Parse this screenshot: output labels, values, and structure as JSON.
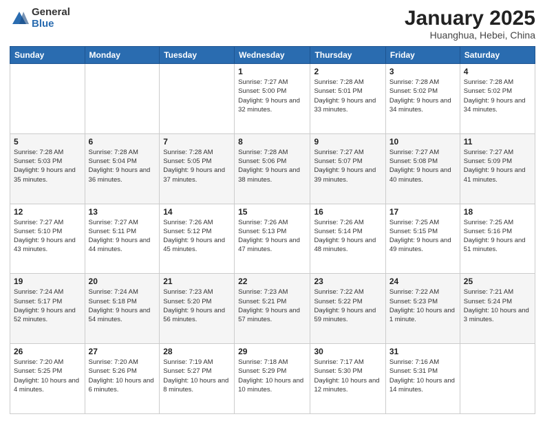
{
  "logo": {
    "general": "General",
    "blue": "Blue"
  },
  "title": "January 2025",
  "subtitle": "Huanghua, Hebei, China",
  "weekdays": [
    "Sunday",
    "Monday",
    "Tuesday",
    "Wednesday",
    "Thursday",
    "Friday",
    "Saturday"
  ],
  "weeks": [
    [
      {
        "day": "",
        "info": ""
      },
      {
        "day": "",
        "info": ""
      },
      {
        "day": "",
        "info": ""
      },
      {
        "day": "1",
        "info": "Sunrise: 7:27 AM\nSunset: 5:00 PM\nDaylight: 9 hours and 32 minutes."
      },
      {
        "day": "2",
        "info": "Sunrise: 7:28 AM\nSunset: 5:01 PM\nDaylight: 9 hours and 33 minutes."
      },
      {
        "day": "3",
        "info": "Sunrise: 7:28 AM\nSunset: 5:02 PM\nDaylight: 9 hours and 34 minutes."
      },
      {
        "day": "4",
        "info": "Sunrise: 7:28 AM\nSunset: 5:02 PM\nDaylight: 9 hours and 34 minutes."
      }
    ],
    [
      {
        "day": "5",
        "info": "Sunrise: 7:28 AM\nSunset: 5:03 PM\nDaylight: 9 hours and 35 minutes."
      },
      {
        "day": "6",
        "info": "Sunrise: 7:28 AM\nSunset: 5:04 PM\nDaylight: 9 hours and 36 minutes."
      },
      {
        "day": "7",
        "info": "Sunrise: 7:28 AM\nSunset: 5:05 PM\nDaylight: 9 hours and 37 minutes."
      },
      {
        "day": "8",
        "info": "Sunrise: 7:28 AM\nSunset: 5:06 PM\nDaylight: 9 hours and 38 minutes."
      },
      {
        "day": "9",
        "info": "Sunrise: 7:27 AM\nSunset: 5:07 PM\nDaylight: 9 hours and 39 minutes."
      },
      {
        "day": "10",
        "info": "Sunrise: 7:27 AM\nSunset: 5:08 PM\nDaylight: 9 hours and 40 minutes."
      },
      {
        "day": "11",
        "info": "Sunrise: 7:27 AM\nSunset: 5:09 PM\nDaylight: 9 hours and 41 minutes."
      }
    ],
    [
      {
        "day": "12",
        "info": "Sunrise: 7:27 AM\nSunset: 5:10 PM\nDaylight: 9 hours and 43 minutes."
      },
      {
        "day": "13",
        "info": "Sunrise: 7:27 AM\nSunset: 5:11 PM\nDaylight: 9 hours and 44 minutes."
      },
      {
        "day": "14",
        "info": "Sunrise: 7:26 AM\nSunset: 5:12 PM\nDaylight: 9 hours and 45 minutes."
      },
      {
        "day": "15",
        "info": "Sunrise: 7:26 AM\nSunset: 5:13 PM\nDaylight: 9 hours and 47 minutes."
      },
      {
        "day": "16",
        "info": "Sunrise: 7:26 AM\nSunset: 5:14 PM\nDaylight: 9 hours and 48 minutes."
      },
      {
        "day": "17",
        "info": "Sunrise: 7:25 AM\nSunset: 5:15 PM\nDaylight: 9 hours and 49 minutes."
      },
      {
        "day": "18",
        "info": "Sunrise: 7:25 AM\nSunset: 5:16 PM\nDaylight: 9 hours and 51 minutes."
      }
    ],
    [
      {
        "day": "19",
        "info": "Sunrise: 7:24 AM\nSunset: 5:17 PM\nDaylight: 9 hours and 52 minutes."
      },
      {
        "day": "20",
        "info": "Sunrise: 7:24 AM\nSunset: 5:18 PM\nDaylight: 9 hours and 54 minutes."
      },
      {
        "day": "21",
        "info": "Sunrise: 7:23 AM\nSunset: 5:20 PM\nDaylight: 9 hours and 56 minutes."
      },
      {
        "day": "22",
        "info": "Sunrise: 7:23 AM\nSunset: 5:21 PM\nDaylight: 9 hours and 57 minutes."
      },
      {
        "day": "23",
        "info": "Sunrise: 7:22 AM\nSunset: 5:22 PM\nDaylight: 9 hours and 59 minutes."
      },
      {
        "day": "24",
        "info": "Sunrise: 7:22 AM\nSunset: 5:23 PM\nDaylight: 10 hours and 1 minute."
      },
      {
        "day": "25",
        "info": "Sunrise: 7:21 AM\nSunset: 5:24 PM\nDaylight: 10 hours and 3 minutes."
      }
    ],
    [
      {
        "day": "26",
        "info": "Sunrise: 7:20 AM\nSunset: 5:25 PM\nDaylight: 10 hours and 4 minutes."
      },
      {
        "day": "27",
        "info": "Sunrise: 7:20 AM\nSunset: 5:26 PM\nDaylight: 10 hours and 6 minutes."
      },
      {
        "day": "28",
        "info": "Sunrise: 7:19 AM\nSunset: 5:27 PM\nDaylight: 10 hours and 8 minutes."
      },
      {
        "day": "29",
        "info": "Sunrise: 7:18 AM\nSunset: 5:29 PM\nDaylight: 10 hours and 10 minutes."
      },
      {
        "day": "30",
        "info": "Sunrise: 7:17 AM\nSunset: 5:30 PM\nDaylight: 10 hours and 12 minutes."
      },
      {
        "day": "31",
        "info": "Sunrise: 7:16 AM\nSunset: 5:31 PM\nDaylight: 10 hours and 14 minutes."
      },
      {
        "day": "",
        "info": ""
      }
    ]
  ]
}
